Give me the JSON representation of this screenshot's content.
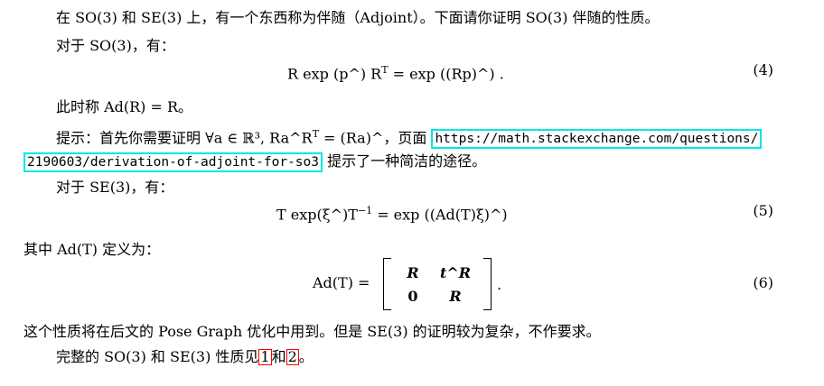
{
  "para1": "在 SO(3) 和 SE(3) 上，有一个东西称为伴随（Adjoint）。下面请你证明 SO(3) 伴随的性质。",
  "para2": "对于 SO(3)，有：",
  "eq4": {
    "lhs": "R exp (p^) R",
    "lhs_sup": "T",
    "rhs": "= exp ((Rp)^) .",
    "num": "(4)"
  },
  "para3": "此时称 Ad(R) = R。",
  "para4": {
    "prefix": "提示：首先你需要证明 ∀a ∈ ℝ³, Ra^R",
    "sup": "T",
    "mid": " = (Ra)^，页面 ",
    "url_part1": "https://math.stackexchange.com/questions/",
    "url_part2": "2190603/derivation-of-adjoint-for-so3",
    "suffix": " 提示了一种简洁的途径。"
  },
  "para5": "对于 SE(3)，有：",
  "eq5": {
    "lhs": "T exp(ξ^)T",
    "lhs_sup": "−1",
    "rhs": "= exp ((Ad(T)ξ)^)",
    "num": "(5)"
  },
  "para6": "其中 Ad(T) 定义为：",
  "eq6": {
    "lhs": "Ad(T) =",
    "m11": "R",
    "m12": "t^R",
    "m21": "0",
    "m22": "R",
    "tail": ".",
    "num": "(6)"
  },
  "para7": "这个性质将在后文的 Pose Graph 优化中用到。但是 SE(3) 的证明较为复杂，不作要求。",
  "para8": {
    "prefix": "完整的 SO(3) 和 SE(3) 性质见",
    "ref1": "1",
    "mid": "和",
    "ref2": "2",
    "suffix": "。"
  },
  "colors": {
    "url_border": "#00e6e6",
    "ref_border": "#ff0000"
  }
}
